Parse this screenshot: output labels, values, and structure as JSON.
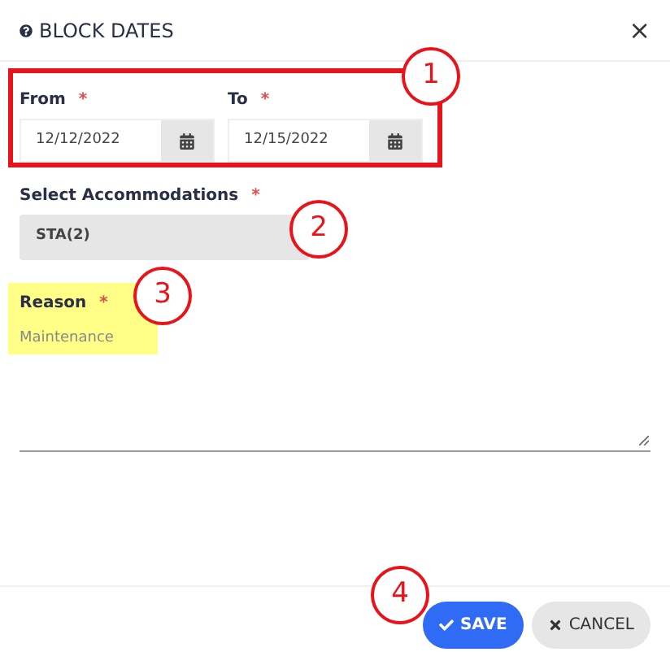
{
  "dialog": {
    "title": "BLOCK DATES",
    "close": "×"
  },
  "date_range": [
    {
      "label": "From",
      "required": "*",
      "value": "12/12/2022"
    },
    {
      "label": "To",
      "required": "*",
      "value": "12/15/2022"
    }
  ],
  "accommodations": {
    "label": "Select Accommodations",
    "required": "*",
    "value": "STA(2)"
  },
  "reason": {
    "label": "Reason",
    "required": "*",
    "value": "Maintenance"
  },
  "buttons": [
    {
      "kind": "primary",
      "label": "SAVE"
    },
    {
      "kind": "secondary",
      "label": "CANCEL"
    }
  ],
  "callouts": [
    "1",
    "2",
    "3",
    "4"
  ]
}
